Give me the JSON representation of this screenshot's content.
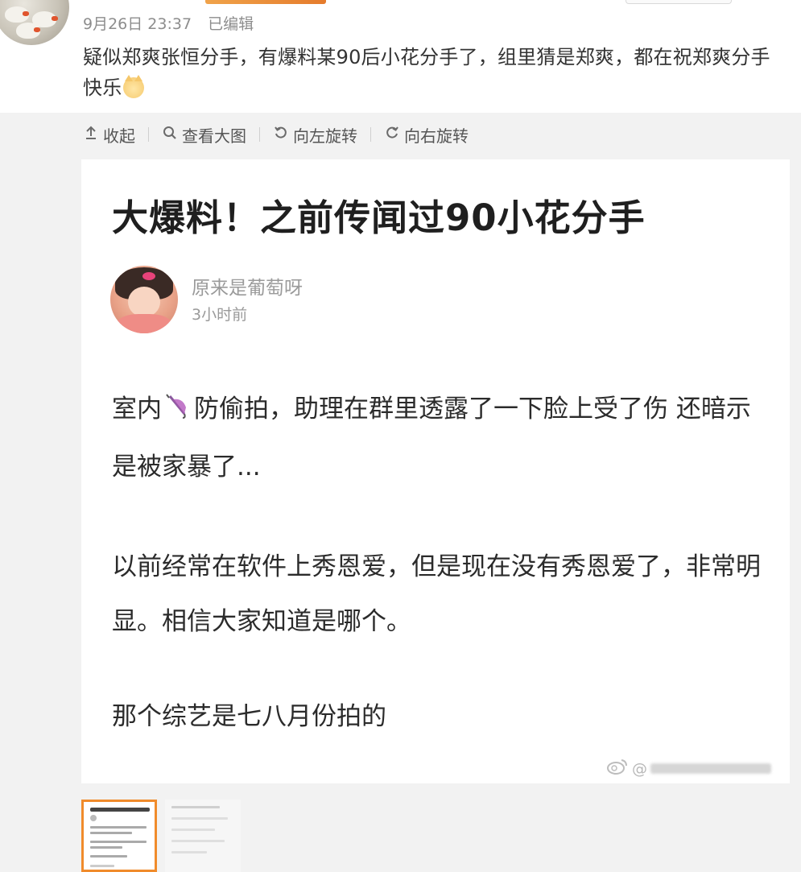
{
  "post": {
    "date": "9月26日 23:37",
    "edited": "已编辑",
    "text": "疑似郑爽张恒分手，有爆料某90后小花分手了，组里猜是郑爽，都在祝郑爽分手快乐",
    "emoji": "cat-emoji"
  },
  "toolbar": {
    "collapse": "收起",
    "view_large": "查看大图",
    "rotate_left": "向左旋转",
    "rotate_right": "向右旋转"
  },
  "article": {
    "title": "大爆料！之前传闻过90小花分手",
    "author": "原来是葡萄呀",
    "time": "3小时前",
    "para1_before": "室内",
    "para1_after": "防偷拍，助理在群里透露了一下脸上受了伤 还暗示是被家暴了...",
    "para2": "以前经常在软件上秀恩爱，但是现在没有秀恩爱了，非常明显。相信大家知道是哪个。",
    "para3": "那个综艺是七八月份拍的"
  },
  "watermark": {
    "prefix": "@"
  },
  "colors": {
    "accent_orange": "#f08b2b",
    "media_bg": "#f2f2f2",
    "meta_gray": "#8d8d8d"
  },
  "icons": [
    "collapse-arrow-icon",
    "magnifier-icon",
    "rotate-left-icon",
    "rotate-right-icon",
    "umbrella-emoji",
    "weibo-logo-icon"
  ]
}
